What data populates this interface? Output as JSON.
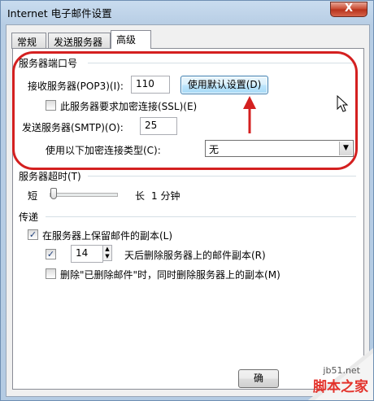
{
  "window": {
    "title": "Internet 电子邮件设置",
    "close_label": "X"
  },
  "tabs": [
    {
      "label": "常规",
      "active": false
    },
    {
      "label": "发送服务器",
      "active": false
    },
    {
      "label": "高级",
      "active": true
    }
  ],
  "server_ports": {
    "group_title": "服务器端口号",
    "incoming_label": "接收服务器(POP3)(I):",
    "incoming_value": "110",
    "defaults_button": "使用默认设置(D)",
    "ssl_label": "此服务器要求加密连接(SSL)(E)",
    "ssl_checked": false,
    "outgoing_label": "发送服务器(SMTP)(O):",
    "outgoing_value": "25",
    "encryption_label": "使用以下加密连接类型(C):",
    "encryption_value": "无"
  },
  "timeout": {
    "group_title": "服务器超时(T)",
    "short_label": "短",
    "long_label": "长",
    "value_text": "1 分钟"
  },
  "delivery": {
    "group_title": "传递",
    "keep_copy_label": "在服务器上保留邮件的副本(L)",
    "keep_copy_checked": true,
    "remove_after_checked": true,
    "remove_after_days": "14",
    "remove_after_label": "天后删除服务器上的邮件副本(R)",
    "remove_deleted_label": "删除\"已删除邮件\"时，同时删除服务器上的副本(M)",
    "remove_deleted_checked": false
  },
  "footer": {
    "ok_button": "确"
  },
  "watermark": {
    "site": "jb51.net",
    "text": "脚本之家"
  },
  "colors": {
    "annotation": "#d42020",
    "focus_blue": "#3c7fb1",
    "watermark_red": "#e3322b"
  }
}
